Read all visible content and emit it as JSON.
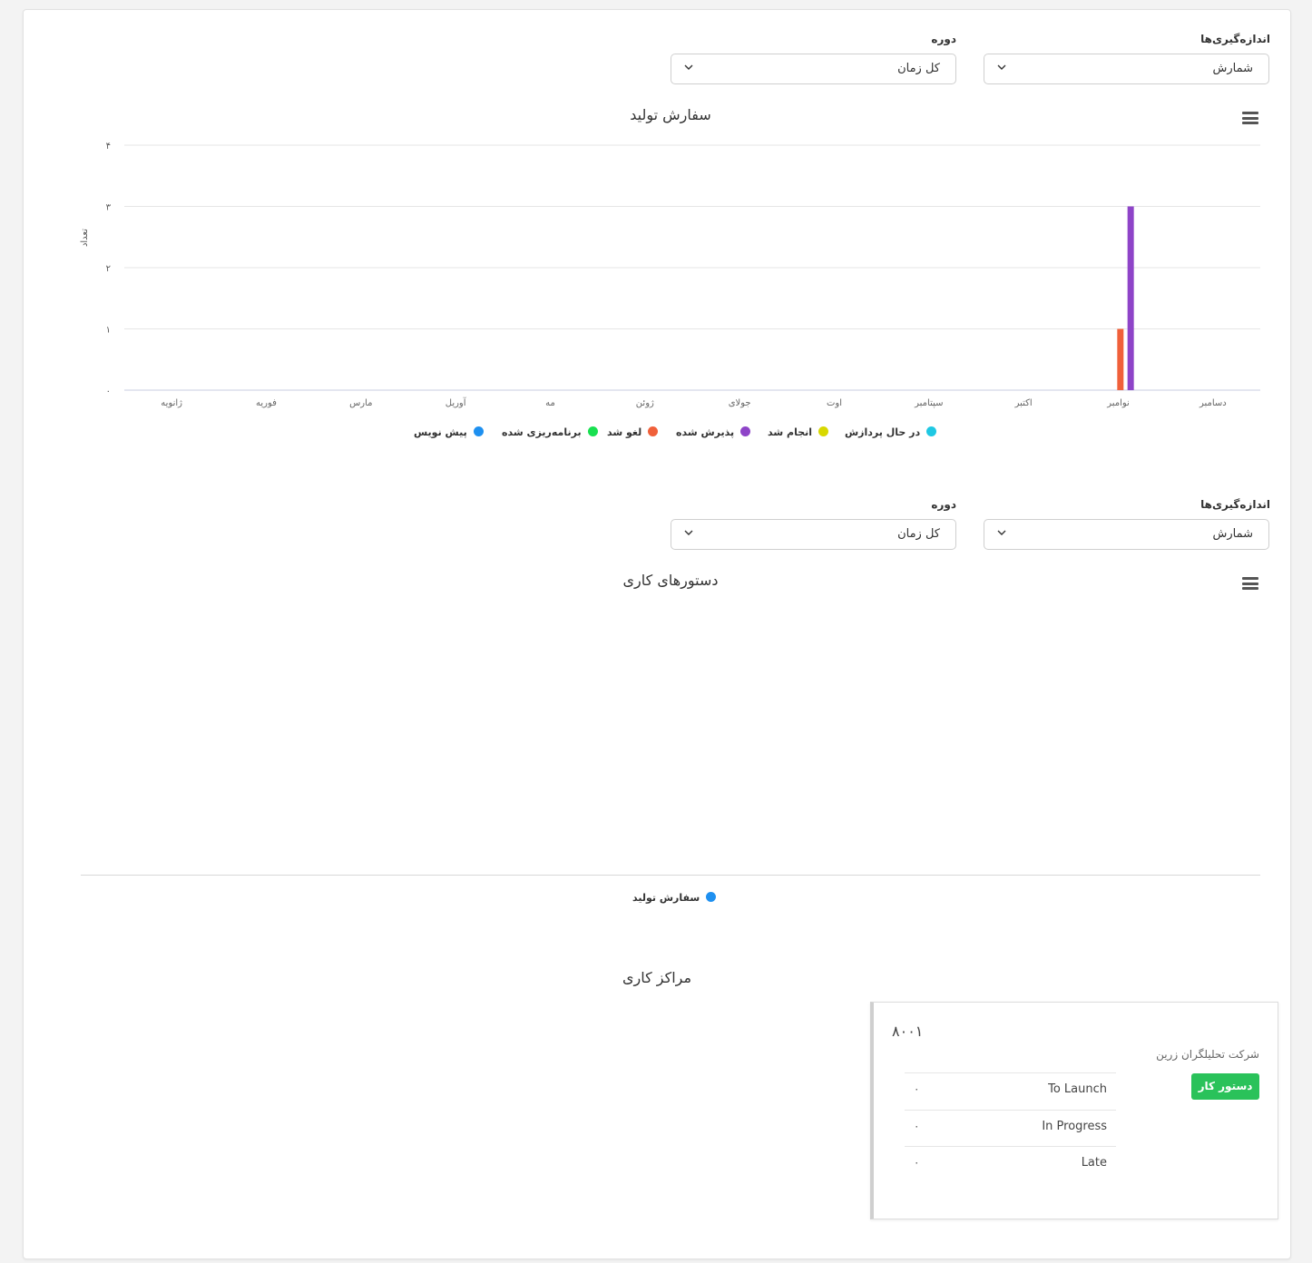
{
  "section1": {
    "measure_label": "اندازه‌گیری‌ها",
    "measure_value": "شمارش",
    "period_label": "دوره",
    "period_value": "کل زمان",
    "title": "سفارش تولید"
  },
  "section2": {
    "measure_label": "اندازه‌گیری‌ها",
    "measure_value": "شمارش",
    "period_label": "دوره",
    "period_value": "کل زمان",
    "title": "دستورهای کاری",
    "legend": [
      {
        "label": "سفارش تولید",
        "color": "#1e90f0"
      }
    ]
  },
  "chart_data": {
    "type": "bar",
    "title": "سفارش تولید",
    "ylabel": "تعداد",
    "xlabel": "",
    "ylim": [
      0,
      4
    ],
    "yticks": [
      "۰",
      "۱",
      "۲",
      "۳",
      "۴"
    ],
    "categories": [
      "ژانویه",
      "فوریه",
      "مارس",
      "آوریل",
      "مه",
      "ژوئن",
      "جولای",
      "اوت",
      "سپتامبر",
      "اکتبر",
      "نوامبر",
      "دسامبر"
    ],
    "series": [
      {
        "name": "در حال پردازش",
        "color": "#1fc8e3",
        "values": [
          0,
          0,
          0,
          0,
          0,
          0,
          0,
          0,
          0,
          0,
          0,
          0
        ]
      },
      {
        "name": "انجام شد",
        "color": "#d8d800",
        "values": [
          0,
          0,
          0,
          0,
          0,
          0,
          0,
          0,
          0,
          0,
          0,
          0
        ]
      },
      {
        "name": "پذیرش شده",
        "color": "#8e44c8",
        "values": [
          0,
          0,
          0,
          0,
          0,
          0,
          0,
          0,
          0,
          0,
          3,
          0
        ]
      },
      {
        "name": "لغو شد",
        "color": "#f0603a",
        "values": [
          0,
          0,
          0,
          0,
          0,
          0,
          0,
          0,
          0,
          0,
          1,
          0
        ]
      },
      {
        "name": "برنامه‌ریزی شده",
        "color": "#18e050",
        "values": [
          0,
          0,
          0,
          0,
          0,
          0,
          0,
          0,
          0,
          0,
          0,
          0
        ]
      },
      {
        "name": "پیش نویس",
        "color": "#1e90f0",
        "values": [
          0,
          0,
          0,
          0,
          0,
          0,
          0,
          0,
          0,
          0,
          0,
          0
        ]
      }
    ]
  },
  "work_centers": {
    "title": "مراکز کاری",
    "card": {
      "code": "۸۰۰۱",
      "company": "شرکت تحلیلگران زرین",
      "button": "دستور کار",
      "stats": [
        {
          "label": "To Launch",
          "value": "۰"
        },
        {
          "label": "In Progress",
          "value": "۰"
        },
        {
          "label": "Late",
          "value": "۰"
        }
      ]
    }
  }
}
